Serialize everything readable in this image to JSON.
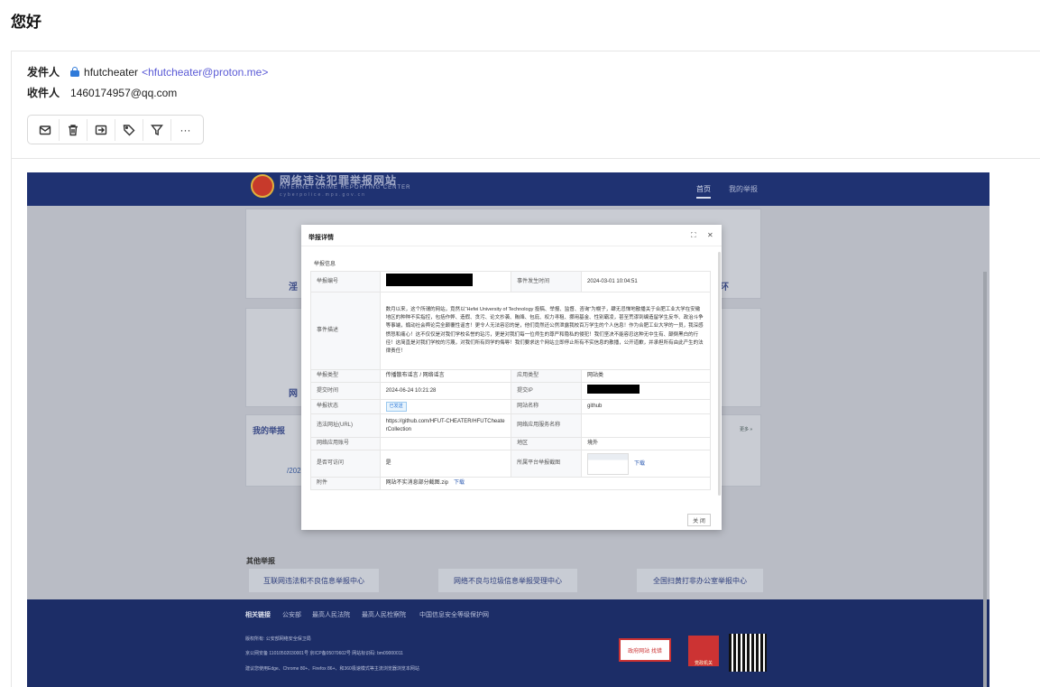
{
  "email": {
    "subject": "您好",
    "from_label": "发件人",
    "from_name": "hfutcheater",
    "from_address": "<hfutcheater@proton.me>",
    "to_label": "收件人",
    "to_address": "1460174957@qq.com",
    "toolbar_icons": [
      "reply-icon",
      "trash-icon",
      "move-icon",
      "tag-icon",
      "filter-icon",
      "more-icon"
    ],
    "more_glyph": "···"
  },
  "screenshot": {
    "site_title": "网络违法犯罪举报网站",
    "site_subtitle": "INTERNET CRIME REPORTING CENTER",
    "site_domain": "cyberpolice.mps.gov.cn",
    "nav": [
      "首页",
      "我的举报"
    ],
    "bg_labels": [
      "淫",
      "网",
      "环"
    ],
    "my_reports": "我的举报",
    "bg_link": "/202",
    "more": "更多 »",
    "other_title": "其他举报",
    "other_buttons": [
      "互联网违法和不良信息举报中心",
      "网络不良与垃圾信息举报受理中心",
      "全国扫黄打非办公室举报中心"
    ],
    "footer_links_title": "相关链接",
    "footer_links": [
      "公安部",
      "最高人民法院",
      "最高人民检察院",
      "中国信息安全等级保护网"
    ],
    "footer_line1": "版权所有: 公安部网络安全保卫局",
    "footer_line2": "京公网安备 11010502030001号  京ICP备05070602号  网站标识码: bm09000011",
    "footer_line3": "建议您使用Edge、Chrome 80+、Firefox 86+、和360极速模式等主流浏览器浏览本网站",
    "badge1": "政府网站 找错",
    "badge2": "党政机关"
  },
  "modal": {
    "title": "举报详情",
    "section": "举报信息",
    "close_button": "关 闭",
    "rows": {
      "report_no_label": "举报编号",
      "event_time_label": "事件发生时间",
      "event_time": "2024-03-01 10:04:51",
      "desc_label": "事件描述",
      "description": "数月以来，这个所谓的网站，竟然以“Hefei University of Technology 投稿、举报、监督、咨询”为幌子，肆无忌惮地散播关于合肥工业大学在安徽地区的种种不实指控，包括作弊、造假、贪污、论文抄袭、贿赂、包庇、权力寻租、挪用基金、性别霸凌，甚至荒谬到编造留学生反华、政治斗争等事端，煽动社会舆论完全颠覆性谣言！更令人无法容忍的是，他们竟然还公然泄露我校百万学生的个人信息！作为合肥工业大学的一员，我深感愤怒和痛心！这不仅仅是对我们学校名誉的玷污，更是对我们每一位师生的尊严和隐私的侵犯！我们坚决不能容忍这种无中生有、颠倒黑白的行径！这简直是对我们学校的污蔑，对我们所有同学的侮辱！我们要求这个网站立即停止所有不实信息的散播，公开道歉，并承担所有由此产生的法律责任！",
      "type_label": "举报类型",
      "type_value": "传播散布谣言 / 网络谣言",
      "app_type_label": "应用类型",
      "app_type": "网站类",
      "submit_time_label": "提交时间",
      "submit_time": "2024-06-24 10:21:28",
      "submit_ip_label": "提交IP",
      "status_label": "举报状态",
      "status": "已发送",
      "site_name_label": "网站名称",
      "site_name": "github",
      "url_label": "违法网址(URL)",
      "url": "https://github.com/HFUT-CHEATER/HFUTCheaterCollection",
      "svc_label": "网络应用服务名称",
      "account_label": "网络应用账号",
      "region_label": "地区",
      "region": "境外",
      "accessible_label": "是否可访问",
      "accessible": "是",
      "platform_label": "所属平台举报截图",
      "download": "下载",
      "attach_label": "附件",
      "attachment": "网站不实消息部分截图.zip"
    }
  }
}
